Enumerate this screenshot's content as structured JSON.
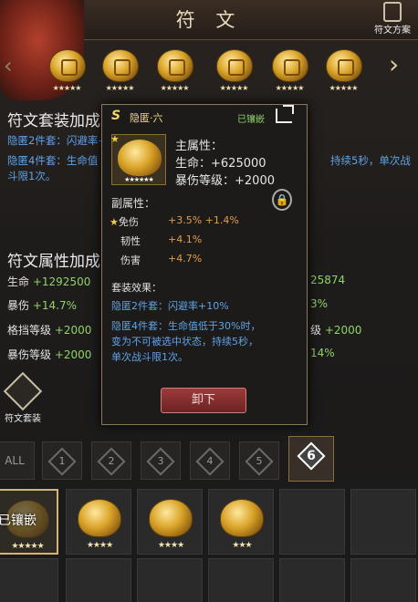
{
  "header": {
    "title": "符 文",
    "scheme_label": "符文方案"
  },
  "rune_bar": {
    "slots": [
      {
        "stars": "★★★★★"
      },
      {
        "stars": "★★★★★"
      },
      {
        "stars": "★★★★★"
      },
      {
        "stars": "★★★★★"
      },
      {
        "stars": "★★★★★"
      },
      {
        "stars": "★★★★★"
      }
    ]
  },
  "set_panel": {
    "title": "符文套装加成",
    "line1": "隐匿2件套：闪避率+10%",
    "line2": "隐匿4件套：生命值低于30%时，变为不可被选中状态，持续5秒，单次战斗限1次。",
    "line2a": "隐匿4件套：生命值",
    "line2b": "持续5秒，单次战",
    "line2c": "斗限1次。"
  },
  "attr_panel": {
    "title": "符文属性加成",
    "left": [
      {
        "name": "生命",
        "value": "+1292500"
      },
      {
        "name": "暴伤",
        "value": "+14.7%"
      },
      {
        "name": "格挡等级",
        "value": "+2000"
      },
      {
        "name": "暴伤等级",
        "value": "+2000"
      }
    ],
    "right": [
      {
        "value": "25874"
      },
      {
        "value": "3%"
      },
      {
        "name": "级",
        "value": "+2000"
      },
      {
        "value": "14%"
      }
    ]
  },
  "sidebar": {
    "set_label": "符文套装"
  },
  "filters": {
    "all": "ALL",
    "tabs": [
      "1",
      "2",
      "3",
      "4",
      "5",
      "6"
    ]
  },
  "inventory": {
    "equipped_label": "已镶嵌",
    "items": [
      {
        "stars": "★★★★★"
      },
      {
        "stars": "★★★★"
      },
      {
        "stars": "★★★★"
      },
      {
        "stars": "★★★"
      }
    ]
  },
  "popup": {
    "name": "隐匿·六",
    "status": "已镶嵌",
    "gem_stars": "★★★★★★",
    "main_title": "主属性：",
    "main": [
      {
        "name": "生命：",
        "value": "+625000"
      },
      {
        "name": "暴伤等级：",
        "value": "+2000"
      }
    ],
    "sub_title": "副属性：",
    "subs": [
      {
        "name": "免伤",
        "value": "+3.5% +1.4%",
        "starred": "★"
      },
      {
        "name": "韧性",
        "value": "+4.1%"
      },
      {
        "name": "伤害",
        "value": "+4.7%"
      }
    ],
    "set_title": "套装效果：",
    "set_line1": "隐匿2件套：闪避率+10%",
    "set_line2": "隐匿4件套：生命值低于30%时，变为不可被选中状态，持续5秒，单次战斗限1次。",
    "set_line2a": "隐匿4件套：生命值低于30%时，",
    "set_line2b": "变为不可被选中状态，持续5秒，",
    "set_line2c": "单次战斗限1次。",
    "unequip": "卸下"
  },
  "colors": {
    "green": "#8fd36a",
    "blue": "#5fa2e8",
    "gold": "#d9a327",
    "orange": "#e39d4a"
  }
}
